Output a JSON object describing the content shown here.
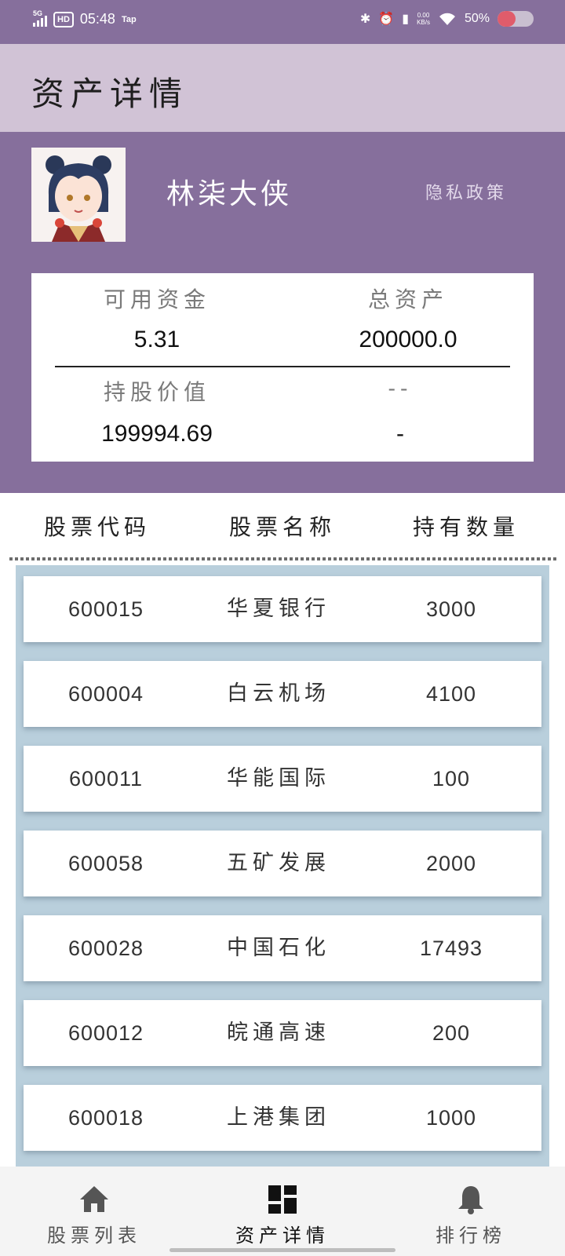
{
  "status_bar": {
    "network": "5G",
    "hd": "HD",
    "time": "05:48",
    "app_tag": "Tap",
    "speed_top": "0.00",
    "speed_bottom": "KB/s",
    "battery": "50%",
    "battery_level": 0.5
  },
  "title": "资产详情",
  "profile": {
    "username": "林柒大侠",
    "privacy_link": "隐私政策"
  },
  "assets": {
    "available_label": "可用资金",
    "available_value": "5.31",
    "total_label": "总资产",
    "total_value": "200000.0",
    "holding_label": "持股价值",
    "holding_value": "199994.69",
    "extra_label": "--",
    "extra_value": "-"
  },
  "table": {
    "headers": [
      "股票代码",
      "股票名称",
      "持有数量"
    ],
    "rows": [
      {
        "code": "600015",
        "name": "华夏银行",
        "qty": "3000"
      },
      {
        "code": "600004",
        "name": "白云机场",
        "qty": "4100"
      },
      {
        "code": "600011",
        "name": "华能国际",
        "qty": "100"
      },
      {
        "code": "600058",
        "name": "五矿发展",
        "qty": "2000"
      },
      {
        "code": "600028",
        "name": "中国石化",
        "qty": "17493"
      },
      {
        "code": "600012",
        "name": "皖通高速",
        "qty": "200"
      },
      {
        "code": "600018",
        "name": "上港集团",
        "qty": "1000"
      }
    ]
  },
  "bottom_nav": {
    "items": [
      {
        "label": "股票列表",
        "icon": "home-icon"
      },
      {
        "label": "资产详情",
        "icon": "dashboard-icon"
      },
      {
        "label": "排行榜",
        "icon": "bell-icon"
      }
    ],
    "active_index": 1
  },
  "colors": {
    "primary": "#866f9c",
    "title_bg": "#d1c3d6",
    "list_bg": "#b9cfdc"
  }
}
